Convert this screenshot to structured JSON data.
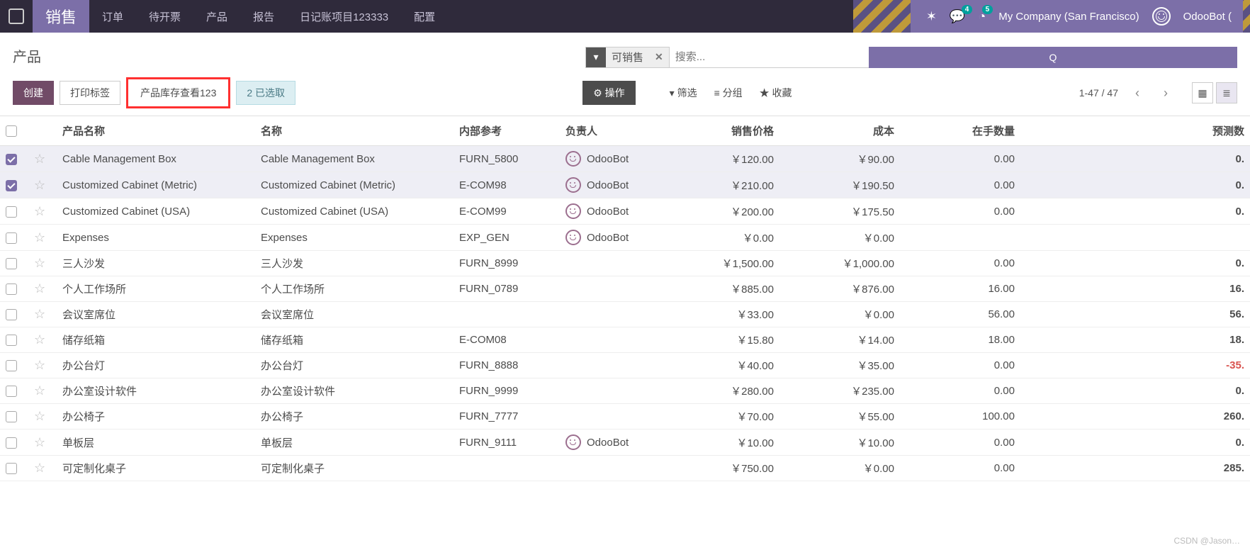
{
  "topbar": {
    "app_name": "销售",
    "menu": [
      "订单",
      "待开票",
      "产品",
      "报告",
      "日记账项目123333",
      "配置"
    ],
    "badges": {
      "messages": "4",
      "activities": "5"
    },
    "company": "My Company (San Francisco)",
    "user": "OdooBot ("
  },
  "breadcrumb": {
    "title": "产品"
  },
  "buttons": {
    "create": "创建",
    "print_labels": "打印标签",
    "stock_view": "产品库存查看123",
    "selected": "2 已选取",
    "actions": "操作",
    "gear": "⚙"
  },
  "search": {
    "filter_tag": "可销售",
    "placeholder": "搜索...",
    "search_btn": "Q"
  },
  "filters": {
    "filter": "筛选",
    "group": "分组",
    "fav": "收藏"
  },
  "pager": {
    "range": "1-47 / 47"
  },
  "columns": [
    "产品名称",
    "名称",
    "内部参考",
    "负责人",
    "销售价格",
    "成本",
    "在手数量",
    "预测数"
  ],
  "rows": [
    {
      "checked": true,
      "pname": "Cable Management Box",
      "name": "Cable Management Box",
      "ref": "FURN_5800",
      "resp": "OdooBot",
      "price": "￥120.00",
      "cost": "￥90.00",
      "qty": "0.00",
      "fc": "0."
    },
    {
      "checked": true,
      "pname": "Customized Cabinet (Metric)",
      "name": "Customized Cabinet (Metric)",
      "ref": "E-COM98",
      "resp": "OdooBot",
      "price": "￥210.00",
      "cost": "￥190.50",
      "qty": "0.00",
      "fc": "0."
    },
    {
      "checked": false,
      "pname": "Customized Cabinet (USA)",
      "name": "Customized Cabinet (USA)",
      "ref": "E-COM99",
      "resp": "OdooBot",
      "price": "￥200.00",
      "cost": "￥175.50",
      "qty": "0.00",
      "fc": "0."
    },
    {
      "checked": false,
      "pname": "Expenses",
      "name": "Expenses",
      "ref": "EXP_GEN",
      "resp": "OdooBot",
      "price": "￥0.00",
      "cost": "￥0.00",
      "qty": "",
      "fc": ""
    },
    {
      "checked": false,
      "pname": "三人沙发",
      "name": "三人沙发",
      "ref": "FURN_8999",
      "resp": "",
      "price": "￥1,500.00",
      "cost": "￥1,000.00",
      "qty": "0.00",
      "fc": "0."
    },
    {
      "checked": false,
      "pname": "个人工作场所",
      "name": "个人工作场所",
      "ref": "FURN_0789",
      "resp": "",
      "price": "￥885.00",
      "cost": "￥876.00",
      "qty": "16.00",
      "fc": "16."
    },
    {
      "checked": false,
      "pname": "会议室席位",
      "name": "会议室席位",
      "ref": "",
      "resp": "",
      "price": "￥33.00",
      "cost": "￥0.00",
      "qty": "56.00",
      "fc": "56."
    },
    {
      "checked": false,
      "pname": "储存纸箱",
      "name": "储存纸箱",
      "ref": "E-COM08",
      "resp": "",
      "price": "￥15.80",
      "cost": "￥14.00",
      "qty": "18.00",
      "fc": "18."
    },
    {
      "checked": false,
      "pname": "办公台灯",
      "name": "办公台灯",
      "ref": "FURN_8888",
      "resp": "",
      "price": "￥40.00",
      "cost": "￥35.00",
      "qty": "0.00",
      "fc": "-35.",
      "neg": true
    },
    {
      "checked": false,
      "pname": "办公室设计软件",
      "name": "办公室设计软件",
      "ref": "FURN_9999",
      "resp": "",
      "price": "￥280.00",
      "cost": "￥235.00",
      "qty": "0.00",
      "fc": "0."
    },
    {
      "checked": false,
      "pname": "办公椅子",
      "name": "办公椅子",
      "ref": "FURN_7777",
      "resp": "",
      "price": "￥70.00",
      "cost": "￥55.00",
      "qty": "100.00",
      "fc": "260."
    },
    {
      "checked": false,
      "pname": "单板层",
      "name": "单板层",
      "ref": "FURN_9111",
      "resp": "OdooBot",
      "price": "￥10.00",
      "cost": "￥10.00",
      "qty": "0.00",
      "fc": "0."
    },
    {
      "checked": false,
      "pname": "可定制化桌子",
      "name": "可定制化桌子",
      "ref": "",
      "resp": "",
      "price": "￥750.00",
      "cost": "￥0.00",
      "qty": "0.00",
      "fc": "285."
    }
  ],
  "watermark": "CSDN @Jason…"
}
